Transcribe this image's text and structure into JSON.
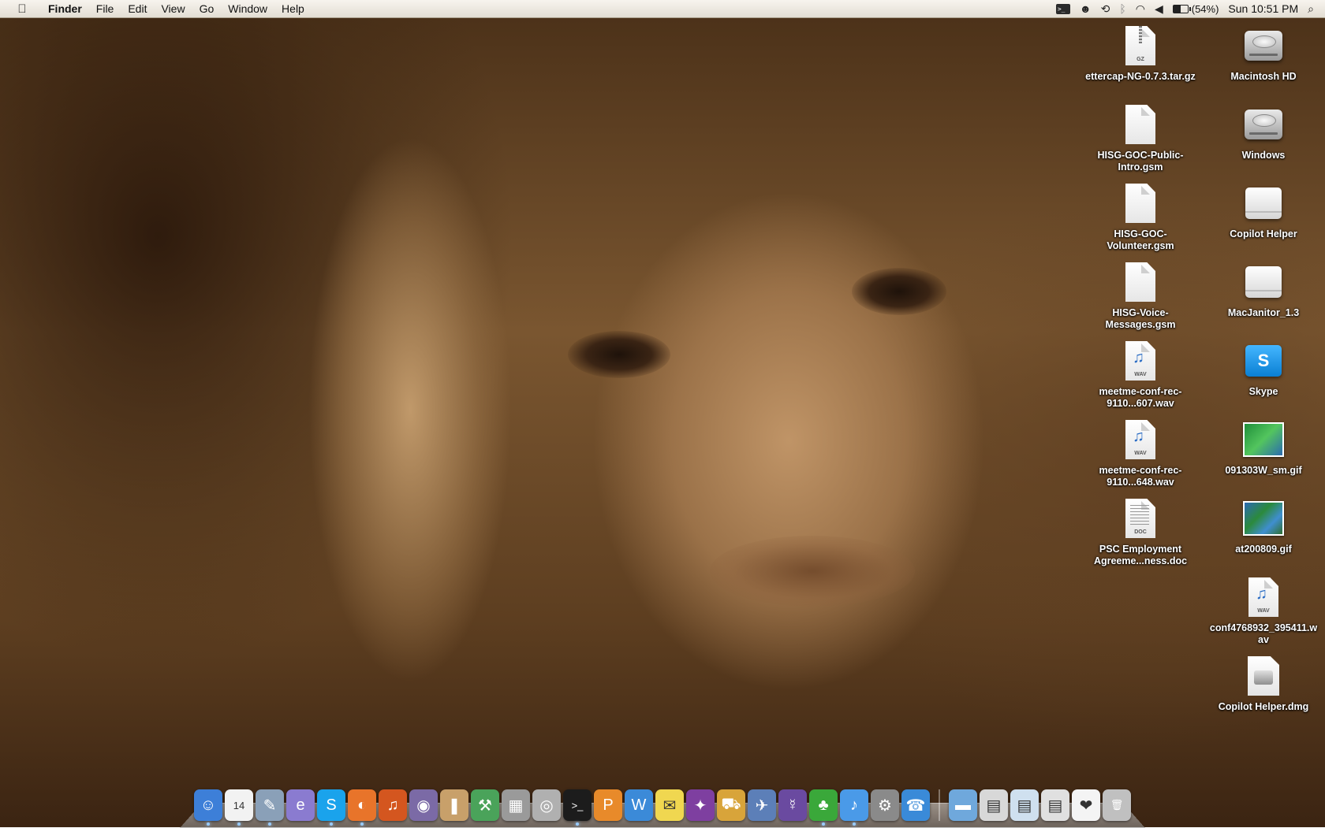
{
  "menubar": {
    "apple_icon": "apple-icon",
    "app_name": "Finder",
    "menus": [
      "File",
      "Edit",
      "View",
      "Go",
      "Window",
      "Help"
    ],
    "status": {
      "battery_percent": "(54%)",
      "battery_level": 0.54,
      "clock": "Sun 10:51 PM",
      "icons": [
        "terminal-icon",
        "robot-icon",
        "time-machine-icon",
        "bluetooth-icon",
        "wifi-icon",
        "volume-icon",
        "battery-icon",
        "spotlight-icon"
      ]
    }
  },
  "desktop": {
    "left_column": [
      {
        "label": "ettercap-NG-0.7.3.tar.gz",
        "kind": "gz",
        "tag": "GZ"
      },
      {
        "label": "HISG-GOC-Public-Intro.gsm",
        "kind": "doc",
        "tag": ""
      },
      {
        "label": "HISG-GOC-Volunteer.gsm",
        "kind": "doc",
        "tag": ""
      },
      {
        "label": "HISG-Voice-Messages.gsm",
        "kind": "doc",
        "tag": ""
      },
      {
        "label": "meetme-conf-rec-9110...607.wav",
        "kind": "wav",
        "tag": "WAV"
      },
      {
        "label": "meetme-conf-rec-9110...648.wav",
        "kind": "wav",
        "tag": "WAV"
      },
      {
        "label": "PSC Employment Agreeme...ness.doc",
        "kind": "worddoc",
        "tag": "DOC"
      }
    ],
    "right_column": [
      {
        "label": "Macintosh HD",
        "kind": "drive"
      },
      {
        "label": "Windows",
        "kind": "drive"
      },
      {
        "label": "Copilot Helper",
        "kind": "volume"
      },
      {
        "label": "MacJanitor_1.3",
        "kind": "volume"
      },
      {
        "label": "Skype",
        "kind": "skype"
      },
      {
        "label": "091303W_sm.gif",
        "kind": "gif-a"
      },
      {
        "label": "at200809.gif",
        "kind": "gif-b"
      },
      {
        "label": "conf4768932_395411.wav",
        "kind": "wav",
        "tag": "WAV"
      },
      {
        "label": "Copilot Helper.dmg",
        "kind": "dmg"
      }
    ]
  },
  "dock": {
    "apps": [
      {
        "name": "finder-icon",
        "glyph": "☺",
        "color": "#3d7fd8",
        "running": true
      },
      {
        "name": "ical-icon",
        "glyph": "14",
        "color": "#f2f2f2",
        "running": true
      },
      {
        "name": "preview-icon",
        "glyph": "✎",
        "color": "#8aa0b8",
        "running": true
      },
      {
        "name": "internet-explorer-icon",
        "glyph": "e",
        "color": "#8a7bd0",
        "running": false
      },
      {
        "name": "skype-icon",
        "glyph": "S",
        "color": "#1aa3ec",
        "running": true
      },
      {
        "name": "firefox-icon",
        "glyph": "◐",
        "color": "#e8742a",
        "running": true
      },
      {
        "name": "audacity-icon",
        "glyph": "♫",
        "color": "#d4561f",
        "running": false
      },
      {
        "name": "network-icon",
        "glyph": "◉",
        "color": "#7b6aa6",
        "running": false
      },
      {
        "name": "book-icon",
        "glyph": "❚",
        "color": "#c8a06a",
        "running": false
      },
      {
        "name": "utility-icon",
        "glyph": "⚒",
        "color": "#4aa35a",
        "running": false
      },
      {
        "name": "calculator-icon",
        "glyph": "▦",
        "color": "#9a9a9a",
        "running": false
      },
      {
        "name": "dvd-player-icon",
        "glyph": "◎",
        "color": "#b0b0b0",
        "running": false
      },
      {
        "name": "terminal-icon",
        "glyph": ">_",
        "color": "#1c1c1c",
        "running": true
      },
      {
        "name": "pages-icon",
        "glyph": "P",
        "color": "#e88a2a",
        "running": false
      },
      {
        "name": "word-icon",
        "glyph": "W",
        "color": "#3b8ad8",
        "running": false
      },
      {
        "name": "stickies-icon",
        "glyph": "✉",
        "color": "#f0d750",
        "running": false
      },
      {
        "name": "itunes-alt-icon",
        "glyph": "✦",
        "color": "#7e3fa0",
        "running": false
      },
      {
        "name": "transmit-icon",
        "glyph": "⛟",
        "color": "#d8a43a",
        "running": false
      },
      {
        "name": "xcode-icon",
        "glyph": "✈",
        "color": "#5c7fb8",
        "running": false
      },
      {
        "name": "adium-alt-icon",
        "glyph": "☿",
        "color": "#6a4aa0",
        "running": false
      },
      {
        "name": "adium-icon",
        "glyph": "♣",
        "color": "#3aa83a",
        "running": true
      },
      {
        "name": "itunes-icon",
        "glyph": "♪",
        "color": "#4a9ae8",
        "running": true
      },
      {
        "name": "system-preferences-icon",
        "glyph": "⚙",
        "color": "#8a8a8a",
        "running": false
      },
      {
        "name": "ichat-icon",
        "glyph": "☎",
        "color": "#3a8ad8",
        "running": false
      }
    ],
    "stacks": [
      {
        "name": "documents-folder-icon",
        "glyph": "▬",
        "color": "#6fa8dc"
      },
      {
        "name": "window-thumb-1-icon",
        "glyph": "▤",
        "color": "#d8d8d8"
      },
      {
        "name": "window-thumb-2-icon",
        "glyph": "▤",
        "color": "#cfe0ef"
      },
      {
        "name": "window-thumb-3-icon",
        "glyph": "▤",
        "color": "#e0e0e0"
      },
      {
        "name": "lips-icon",
        "glyph": "❤",
        "color": "#f4f4f4"
      },
      {
        "name": "trash-icon",
        "glyph": "🗑",
        "color": "#c0c0c0"
      }
    ]
  }
}
